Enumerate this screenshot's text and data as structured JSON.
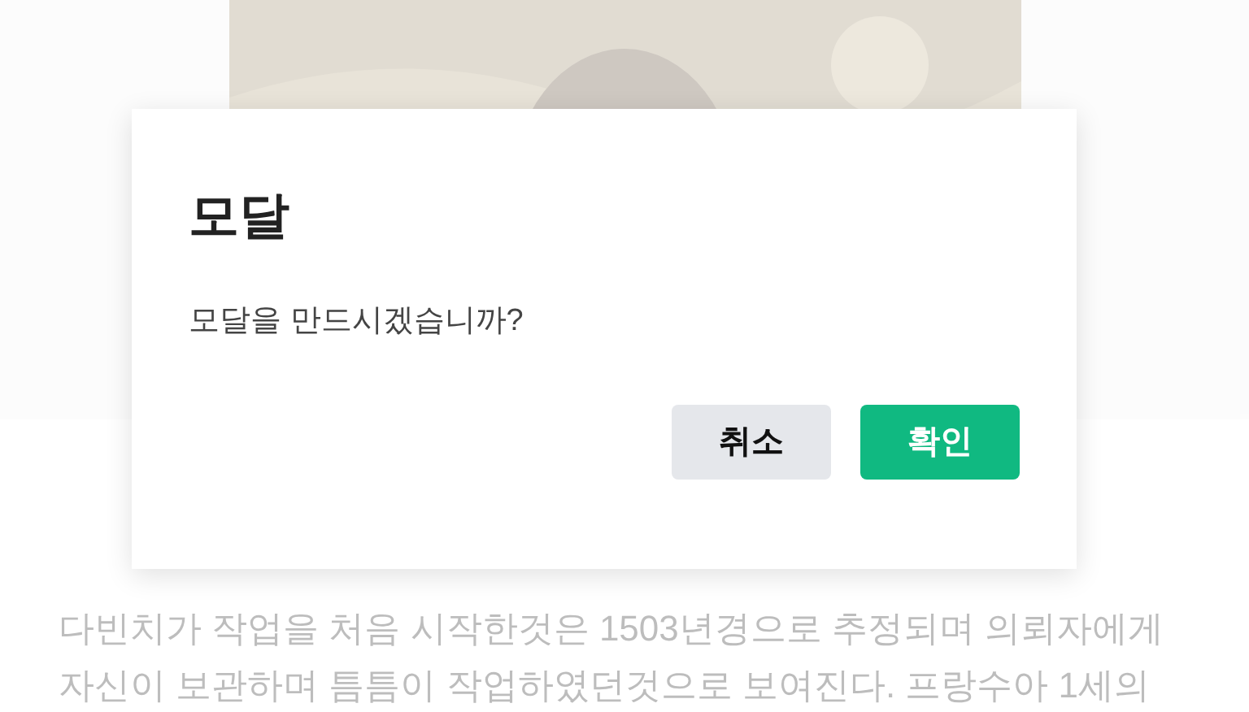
{
  "background": {
    "article_lines": [
      "다빈치가 작업을 처음 시작한것은 1503년경으로 추정되며 의뢰자에게",
      "자신이 보관하며 틈틈이 작업하였던것으로 보여진다. 프랑수아 1세의"
    ]
  },
  "modal": {
    "title": "모달",
    "message": "모달을 만드시겠습니까?",
    "buttons": [
      {
        "label": "취소",
        "kind": "cancel"
      },
      {
        "label": "확인",
        "kind": "confirm"
      }
    ]
  }
}
